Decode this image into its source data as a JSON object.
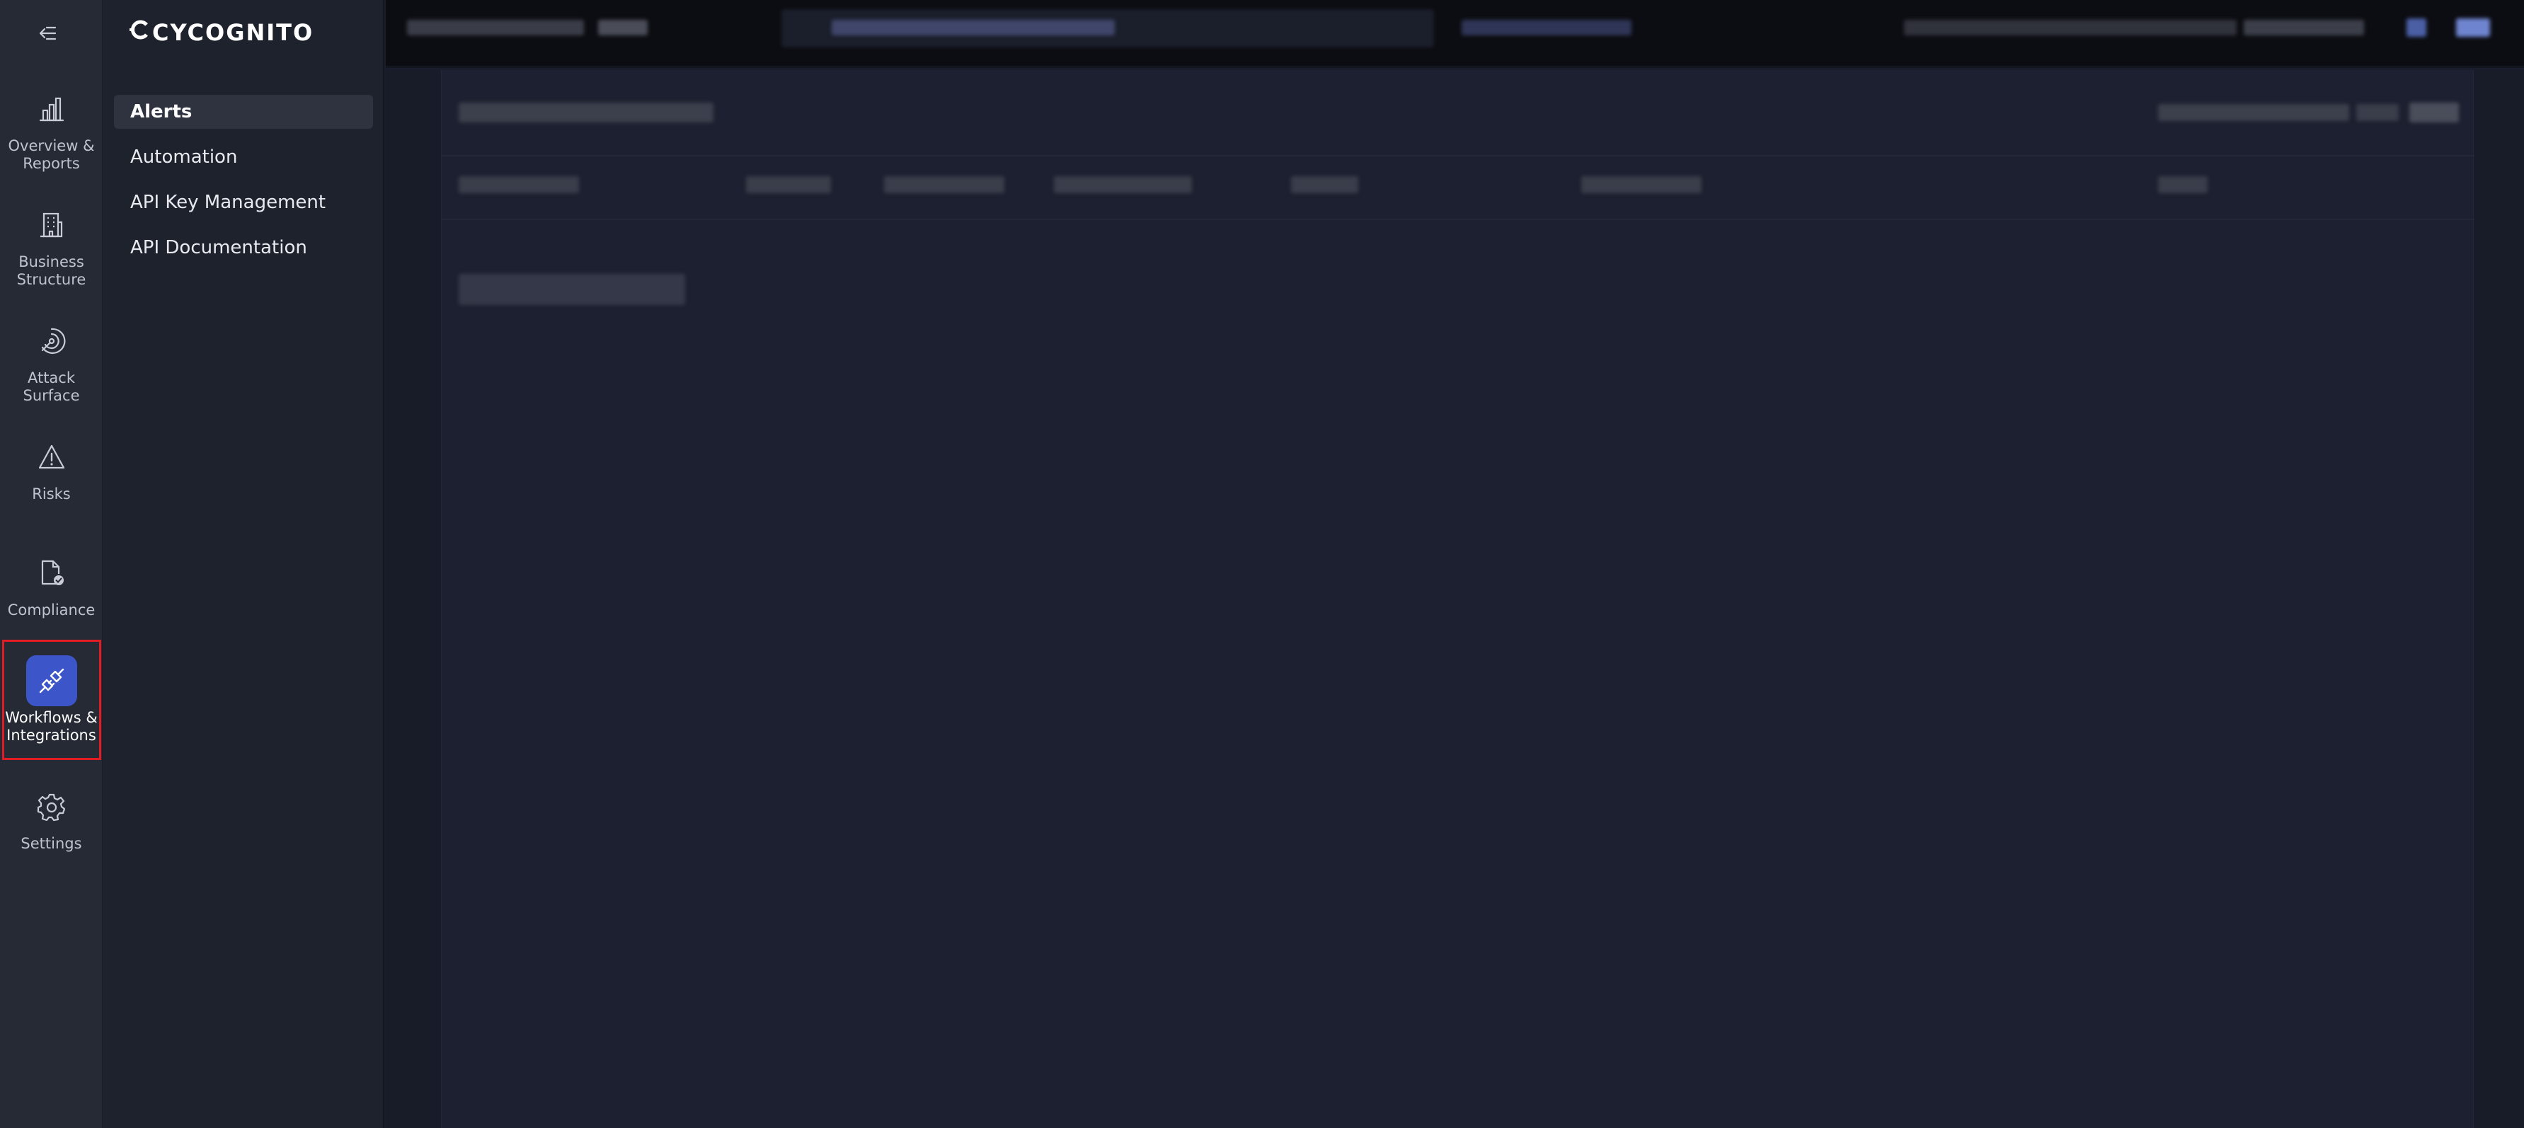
{
  "brand": {
    "name": "CYCOGNITO"
  },
  "rail": {
    "items": [
      {
        "id": "overview",
        "label": "Overview &\nReports",
        "icon": "bar-chart-icon"
      },
      {
        "id": "business",
        "label": "Business\nStructure",
        "icon": "building-icon"
      },
      {
        "id": "attack",
        "label": "Attack\nSurface",
        "icon": "radar-icon"
      },
      {
        "id": "risks",
        "label": "Risks",
        "icon": "warning-triangle-icon"
      },
      {
        "id": "compliance",
        "label": "Compliance",
        "icon": "document-check-icon"
      },
      {
        "id": "workflows",
        "label": "Workflows &\nIntegrations",
        "icon": "plug-icon",
        "active": true
      },
      {
        "id": "settings",
        "label": "Settings",
        "icon": "gear-icon"
      }
    ]
  },
  "submenu": {
    "items": [
      {
        "label": "Alerts",
        "active": true
      },
      {
        "label": "Automation"
      },
      {
        "label": "API Key Management"
      },
      {
        "label": "API Documentation"
      }
    ]
  },
  "colors": {
    "accent": "#3c56c9",
    "highlight": "#e11c25"
  }
}
